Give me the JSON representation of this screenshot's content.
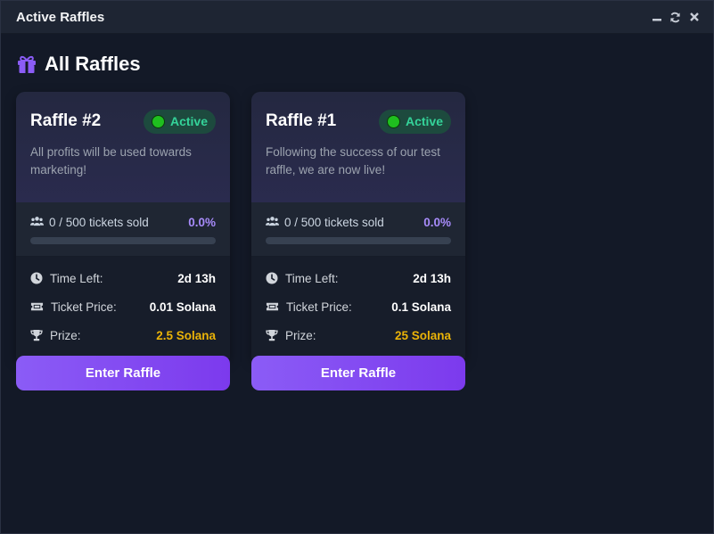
{
  "window": {
    "title": "Active Raffles"
  },
  "heading": {
    "title": "All Raffles",
    "icon": "gift-icon"
  },
  "colors": {
    "accent": "#8b5cf6",
    "active": "#34d399",
    "prize": "#eab308"
  },
  "raffles": [
    {
      "title": "Raffle #2",
      "status": "Active",
      "description": "All profits will be used towards marketing!",
      "tickets_text": "0 / 500 tickets sold",
      "percent_text": "0.0%",
      "progress": 0.0,
      "time_left_label": "Time Left:",
      "time_left": "2d 13h",
      "ticket_price_label": "Ticket Price:",
      "ticket_price": "0.01 Solana",
      "prize_label": "Prize:",
      "prize": "2.5 Solana",
      "button": "Enter Raffle"
    },
    {
      "title": "Raffle #1",
      "status": "Active",
      "description": "Following the success of our test raffle, we are now live!",
      "tickets_text": "0 / 500 tickets sold",
      "percent_text": "0.0%",
      "progress": 0.0,
      "time_left_label": "Time Left:",
      "time_left": "2d 13h",
      "ticket_price_label": "Ticket Price:",
      "ticket_price": "0.1 Solana",
      "prize_label": "Prize:",
      "prize": "25 Solana",
      "button": "Enter Raffle"
    }
  ]
}
